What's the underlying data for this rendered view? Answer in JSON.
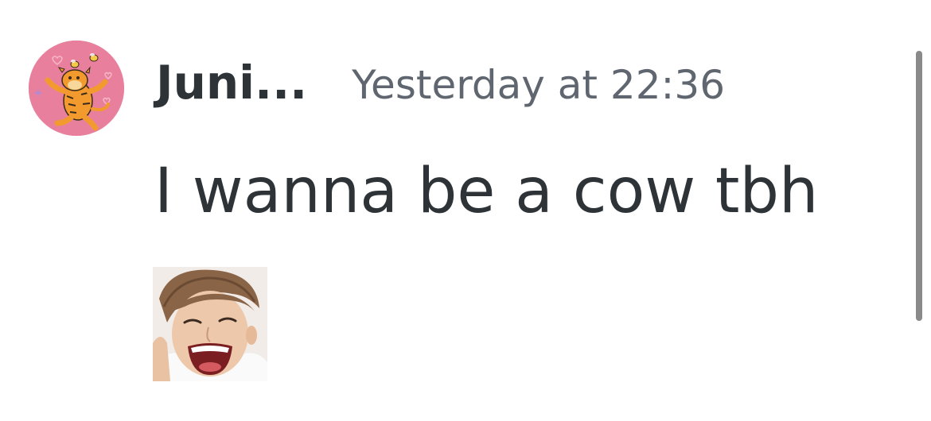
{
  "message": {
    "author": {
      "username": "Juni...",
      "avatar_icon": "tigger-avatar"
    },
    "timestamp": "Yesterday at 22:36",
    "content": "I wanna be a cow tbh",
    "sticker": {
      "icon": "laughing-person-sticker"
    }
  },
  "colors": {
    "avatar_background": "#e8809d",
    "username": "#2e3338",
    "timestamp": "#5f6670",
    "content": "#2e3338"
  }
}
